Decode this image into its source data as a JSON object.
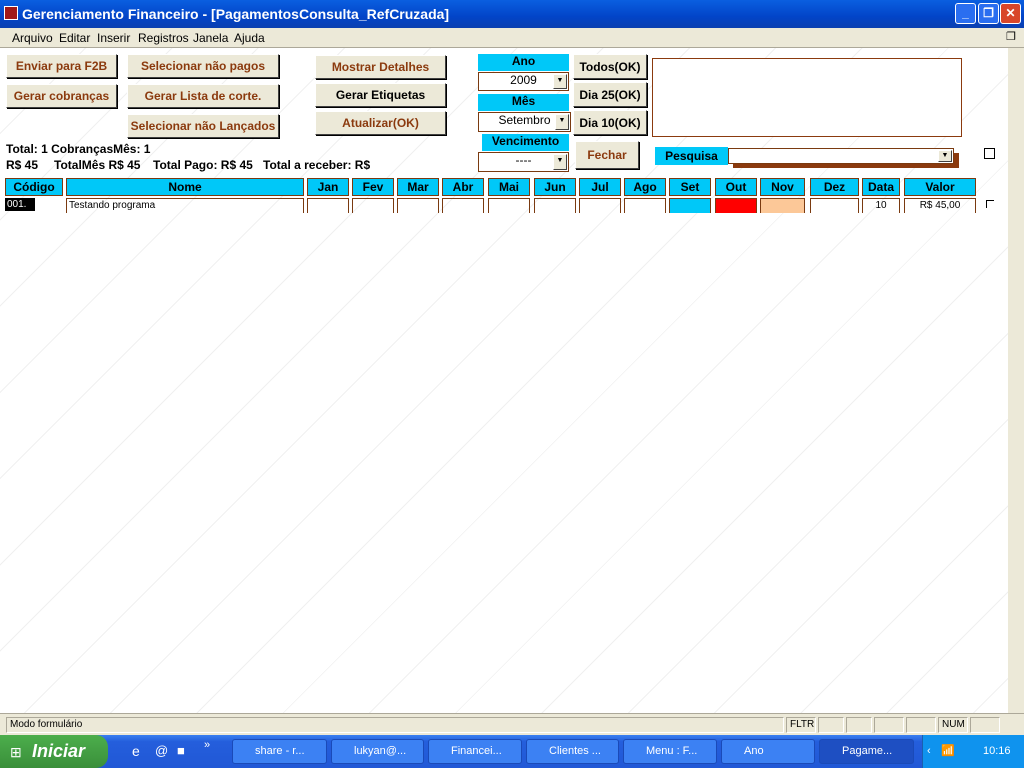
{
  "window": {
    "title": "Gerenciamento Financeiro - [PagamentosConsulta_RefCruzada]"
  },
  "menu": [
    "Arquivo",
    "Editar",
    "Inserir",
    "Registros",
    "Janela",
    "Ajuda"
  ],
  "buttons": {
    "enviar_f2b": "Enviar para  F2B",
    "gerar_cobrancas": "Gerar cobranças",
    "selecionar_nao_pagos": "Selecionar não pagos",
    "gerar_lista_corte": "Gerar Lista de corte.",
    "selecionar_nao_lancados": "Selecionar não Lançados",
    "mostrar_detalhes": "Mostrar Detalhes",
    "gerar_etiquetas": "Gerar Etiquetas",
    "atualizar": "Atualizar(OK)",
    "todos": "Todos(OK)",
    "dia25": "Dia 25(OK)",
    "dia10": "Dia 10(OK)",
    "fechar": "Fechar"
  },
  "filters": {
    "ano_label": "Ano",
    "ano_value": "2009",
    "mes_label": "Mês",
    "mes_value": "Setembro",
    "vencimento_label": "Vencimento",
    "vencimento_value": "----",
    "pesquisa_label": "Pesquisa",
    "pesquisa_value": ""
  },
  "totals": {
    "line1": "Total: 1 CobrançasMês: 1",
    "rs": "R$ 45",
    "total_mes": "TotalMês R$ 45",
    "total_pago": "Total Pago: R$ 45",
    "total_receber": "Total a receber: R$"
  },
  "table": {
    "headers": [
      "Código",
      "Nome",
      "Jan",
      "Fev",
      "Mar",
      "Abr",
      "Mai",
      "Jun",
      "Jul",
      "Ago",
      "Set",
      "Out",
      "Nov",
      "Dez",
      "Data",
      "Valor"
    ],
    "rows": [
      {
        "codigo": "001.",
        "nome": "Testando programa",
        "data": "10",
        "valor": "R$ 45,00",
        "month_colors": {
          "Set": "#00c8f8",
          "Out": "#ff0000",
          "Nov": "#fcc898"
        }
      }
    ]
  },
  "status": {
    "mode": "Modo formulário",
    "fltr": "FLTR",
    "num": "NUM"
  },
  "taskbar": {
    "start": "Iniciar",
    "tasks": [
      "share - r...",
      "lukyan@...",
      "Financei...",
      "Clientes ...",
      "Menu : F...",
      "Ano",
      "Pagame..."
    ],
    "clock": "10:16"
  }
}
